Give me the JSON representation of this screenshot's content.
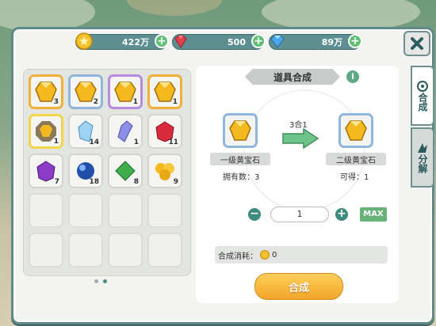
{
  "currency": {
    "gold": {
      "value": "422万",
      "icon": "gold-coin-icon",
      "color": "#f3c12a"
    },
    "ruby": {
      "value": "500",
      "icon": "ruby-gem-icon",
      "color": "#e2404a"
    },
    "diamond": {
      "value": "89万",
      "icon": "diamond-icon",
      "color": "#4aa7ec"
    }
  },
  "inventory": {
    "items": [
      {
        "icon": "yellow-gem-icon",
        "count": "3",
        "rarity": "orange"
      },
      {
        "icon": "yellow-gem-icon",
        "count": "2",
        "rarity": "blue"
      },
      {
        "icon": "yellow-gem-icon",
        "count": "1",
        "rarity": "purple"
      },
      {
        "icon": "yellow-gem-icon",
        "count": "1",
        "rarity": "orange"
      },
      {
        "icon": "octagon-yellow-gem-icon",
        "count": "1",
        "rarity": "yellow"
      },
      {
        "icon": "blue-crystal-icon",
        "count": "14",
        "rarity": "none"
      },
      {
        "icon": "purple-crystal-icon",
        "count": "1",
        "rarity": "none"
      },
      {
        "icon": "red-gem-icon",
        "count": "11",
        "rarity": "none"
      },
      {
        "icon": "purple-gem-icon",
        "count": "7",
        "rarity": "none"
      },
      {
        "icon": "blue-orb-icon",
        "count": "18",
        "rarity": "none"
      },
      {
        "icon": "green-gem-icon",
        "count": "8",
        "rarity": "none"
      },
      {
        "icon": "yellow-gold-cluster-icon",
        "count": "9",
        "rarity": "none"
      }
    ],
    "empty_slots": 8
  },
  "synthesis": {
    "title": "道具合成",
    "ratio": "3合1",
    "source": {
      "name": "一级黄宝石",
      "own_label": "拥有数：3"
    },
    "target": {
      "name": "二级黄宝石",
      "get_label": "可得：1"
    },
    "quantity": "1",
    "minus": "−",
    "plus": "+",
    "max_label": "MAX",
    "cost_label": "合成消耗：",
    "cost_value": "0",
    "button_label": "合成"
  },
  "tabs": [
    {
      "label": "合成",
      "active": true
    },
    {
      "label": "分解",
      "active": false
    }
  ]
}
